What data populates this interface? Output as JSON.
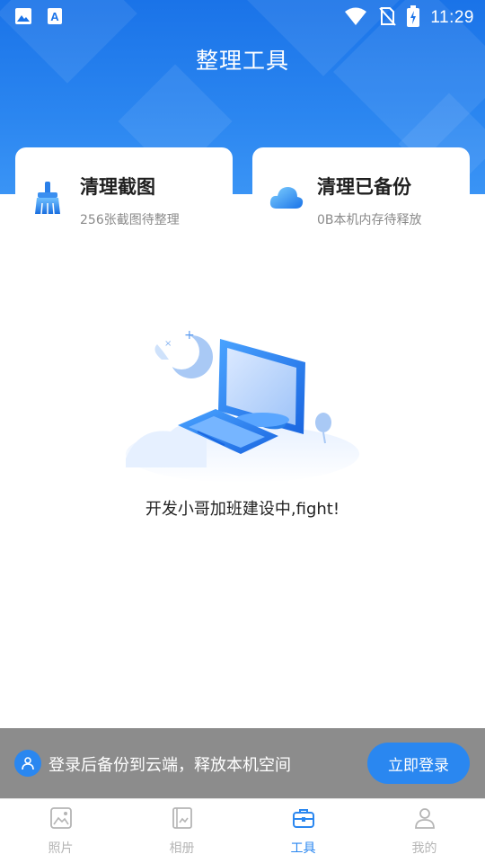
{
  "status_bar": {
    "time": "11:29",
    "left_icons": [
      "image-icon",
      "font-a-icon"
    ],
    "right_icons": [
      "wifi-icon",
      "no-sim-icon",
      "battery-charging-icon"
    ]
  },
  "header": {
    "title": "整理工具"
  },
  "cards": [
    {
      "title": "清理截图",
      "subtitle": "256张截图待整理",
      "icon": "broom-icon"
    },
    {
      "title": "清理已备份",
      "subtitle": "0B本机内存待释放",
      "icon": "cloud-icon"
    }
  ],
  "empty_state": {
    "message": "开发小哥加班建设中,fight!"
  },
  "login_banner": {
    "text": "登录后备份到云端，释放本机空间",
    "button_label": "立即登录"
  },
  "bottom_nav": {
    "items": [
      {
        "label": "照片",
        "icon": "photo-icon",
        "active": false
      },
      {
        "label": "相册",
        "icon": "album-icon",
        "active": false
      },
      {
        "label": "工具",
        "icon": "toolbox-icon",
        "active": true
      },
      {
        "label": "我的",
        "icon": "profile-icon",
        "active": false
      }
    ]
  },
  "colors": {
    "primary": "#2a87f0",
    "header_gradient_top": "#1a73e8",
    "inactive": "#b5b5b5",
    "banner_bg": "#8c8c8c"
  }
}
